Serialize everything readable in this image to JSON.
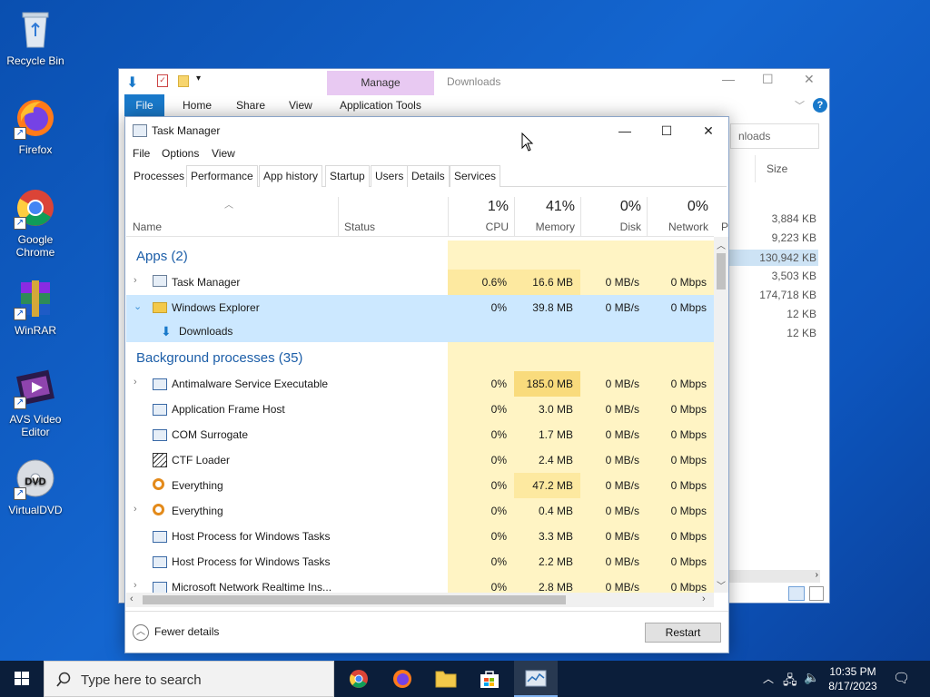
{
  "desktop": {
    "icons": [
      {
        "label": "Recycle Bin"
      },
      {
        "label": "Firefox"
      },
      {
        "label": "Google Chrome"
      },
      {
        "label": "WinRAR"
      },
      {
        "label": "AVS Video Editor"
      },
      {
        "label": "VirtualDVD"
      }
    ]
  },
  "explorer": {
    "title": "Downloads",
    "manage_label": "Manage",
    "tabs": [
      "File",
      "Home",
      "Share",
      "View",
      "Application Tools"
    ],
    "search_placeholder": "nloads",
    "size_header": "Size",
    "sizes": [
      "3,884 KB",
      "9,223 KB",
      "130,942 KB",
      "3,503 KB",
      "174,718 KB",
      "12 KB",
      "12 KB"
    ]
  },
  "task_manager": {
    "title": "Task Manager",
    "menu": [
      "File",
      "Options",
      "View"
    ],
    "tabs": [
      "Processes",
      "Performance",
      "App history",
      "Startup",
      "Users",
      "Details",
      "Services"
    ],
    "columns": {
      "name": "Name",
      "status": "Status",
      "cpu": {
        "pct": "1%",
        "label": "CPU"
      },
      "memory": {
        "pct": "41%",
        "label": "Memory"
      },
      "disk": {
        "pct": "0%",
        "label": "Disk"
      },
      "network": {
        "pct": "0%",
        "label": "Network"
      },
      "power_partial": "P"
    },
    "groups": {
      "apps": "Apps (2)",
      "background": "Background processes (35)"
    },
    "apps": [
      {
        "name": "Task Manager",
        "cpu": "0.6%",
        "mem": "16.6 MB",
        "disk": "0 MB/s",
        "net": "0 Mbps",
        "icon": "task-manager-icon"
      },
      {
        "name": "Windows Explorer",
        "cpu": "0%",
        "mem": "39.8 MB",
        "disk": "0 MB/s",
        "net": "0 Mbps",
        "icon": "explorer-icon"
      }
    ],
    "explorer_child": "Downloads",
    "background": [
      {
        "name": "Antimalware Service Executable",
        "cpu": "0%",
        "mem": "185.0 MB",
        "disk": "0 MB/s",
        "net": "0 Mbps",
        "expand": true
      },
      {
        "name": "Application Frame Host",
        "cpu": "0%",
        "mem": "3.0 MB",
        "disk": "0 MB/s",
        "net": "0 Mbps",
        "expand": false
      },
      {
        "name": "COM Surrogate",
        "cpu": "0%",
        "mem": "1.7 MB",
        "disk": "0 MB/s",
        "net": "0 Mbps",
        "expand": false
      },
      {
        "name": "CTF Loader",
        "cpu": "0%",
        "mem": "2.4 MB",
        "disk": "0 MB/s",
        "net": "0 Mbps",
        "expand": false
      },
      {
        "name": "Everything",
        "cpu": "0%",
        "mem": "47.2 MB",
        "disk": "0 MB/s",
        "net": "0 Mbps",
        "expand": false
      },
      {
        "name": "Everything",
        "cpu": "0%",
        "mem": "0.4 MB",
        "disk": "0 MB/s",
        "net": "0 Mbps",
        "expand": true
      },
      {
        "name": "Host Process for Windows Tasks",
        "cpu": "0%",
        "mem": "3.3 MB",
        "disk": "0 MB/s",
        "net": "0 Mbps",
        "expand": false
      },
      {
        "name": "Host Process for Windows Tasks",
        "cpu": "0%",
        "mem": "2.2 MB",
        "disk": "0 MB/s",
        "net": "0 Mbps",
        "expand": false
      },
      {
        "name": "Microsoft Network Realtime Ins...",
        "cpu": "0%",
        "mem": "2.8 MB",
        "disk": "0 MB/s",
        "net": "0 Mbps",
        "expand": true
      }
    ],
    "footer": {
      "fewer": "Fewer details",
      "restart": "Restart"
    }
  },
  "taskbar": {
    "search_placeholder": "Type here to search",
    "time": "10:35 PM",
    "date": "8/17/2023"
  },
  "colors": {
    "heat_light": "#fff4c4",
    "heat_mid": "#fde9a0",
    "heat_high": "#f9db7c",
    "selected_row": "#cce8ff",
    "group_text": "#1c5ea8"
  }
}
